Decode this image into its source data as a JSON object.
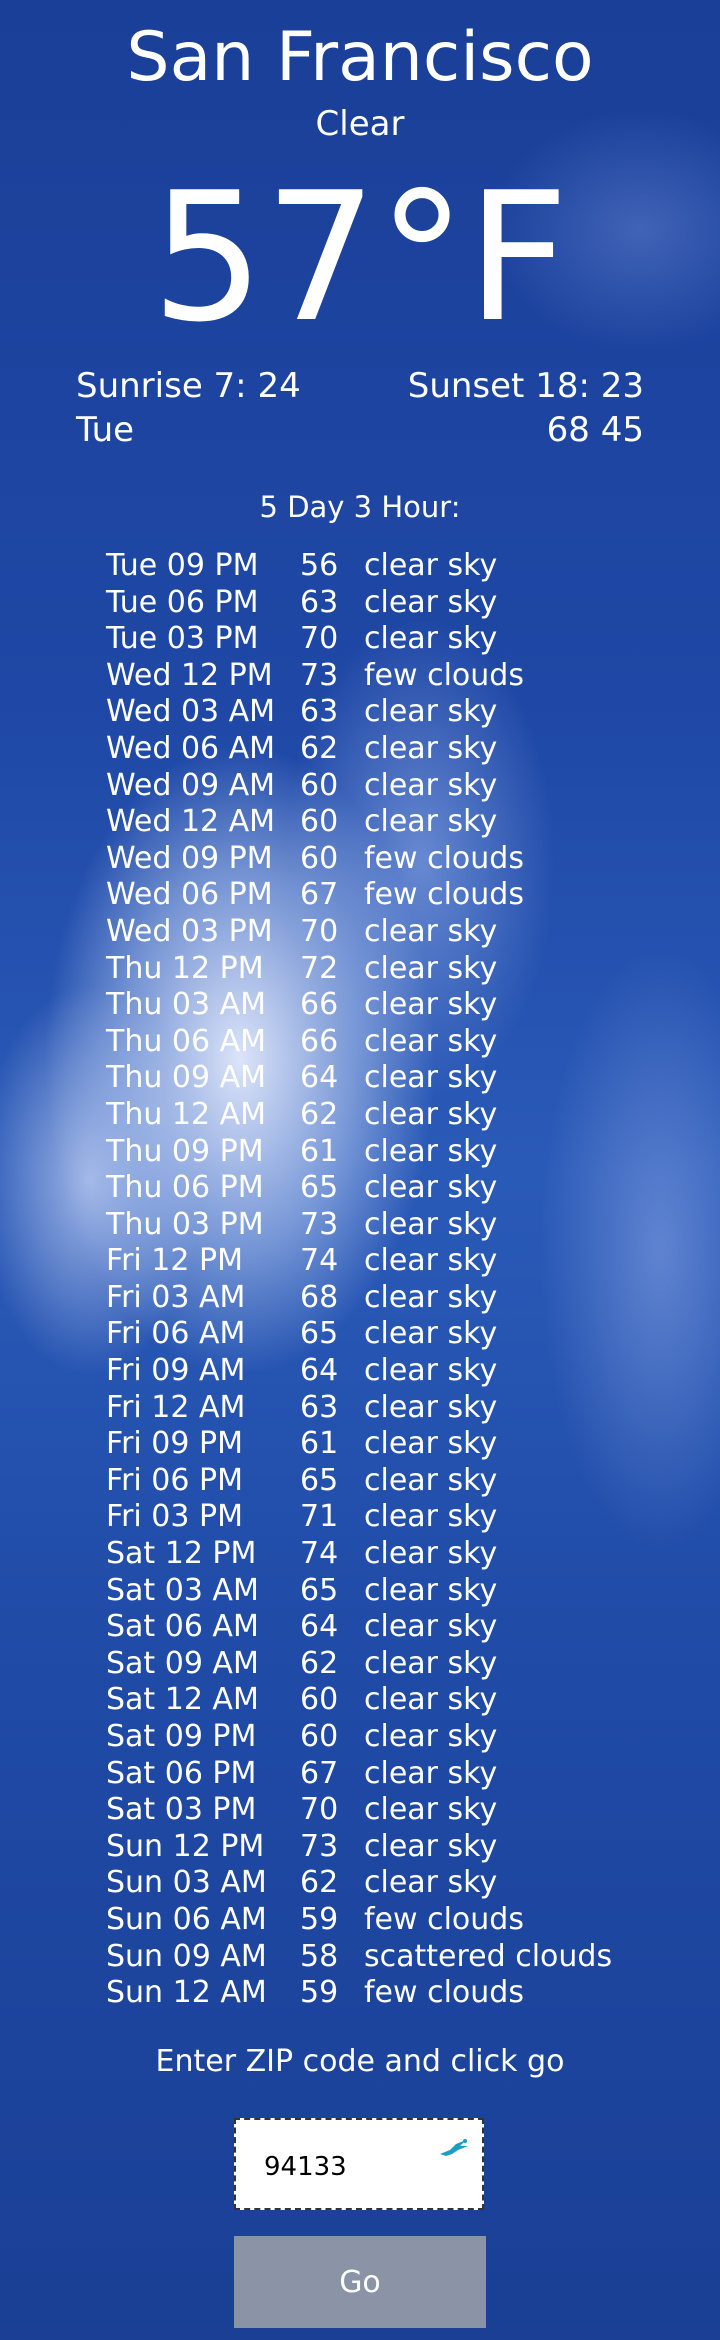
{
  "current": {
    "city": "San Francisco",
    "condition": "Clear",
    "temperature": "57°F",
    "sunrise": "Sunrise 7: 24",
    "sunset": "Sunset 18: 23",
    "day": "Tue",
    "high_low": "68 45"
  },
  "forecast": {
    "title": "5 Day 3 Hour:",
    "rows": [
      {
        "time": "Tue 09 PM",
        "temp": "56",
        "desc": "clear sky"
      },
      {
        "time": "Tue 06 PM",
        "temp": "63",
        "desc": "clear sky"
      },
      {
        "time": "Tue 03 PM",
        "temp": "70",
        "desc": "clear sky"
      },
      {
        "time": "Wed 12 PM",
        "temp": "73",
        "desc": "few clouds"
      },
      {
        "time": "Wed 03 AM",
        "temp": "63",
        "desc": "clear sky"
      },
      {
        "time": "Wed 06 AM",
        "temp": "62",
        "desc": "clear sky"
      },
      {
        "time": "Wed 09 AM",
        "temp": "60",
        "desc": "clear sky"
      },
      {
        "time": "Wed 12 AM",
        "temp": "60",
        "desc": "clear sky"
      },
      {
        "time": "Wed 09 PM",
        "temp": "60",
        "desc": "few clouds"
      },
      {
        "time": "Wed 06 PM",
        "temp": "67",
        "desc": "few clouds"
      },
      {
        "time": "Wed 03 PM",
        "temp": "70",
        "desc": "clear sky"
      },
      {
        "time": "Thu 12 PM",
        "temp": "72",
        "desc": "clear sky"
      },
      {
        "time": "Thu 03 AM",
        "temp": "66",
        "desc": "clear sky"
      },
      {
        "time": "Thu 06 AM",
        "temp": "66",
        "desc": "clear sky"
      },
      {
        "time": "Thu 09 AM",
        "temp": "64",
        "desc": "clear sky"
      },
      {
        "time": "Thu 12 AM",
        "temp": "62",
        "desc": "clear sky"
      },
      {
        "time": "Thu 09 PM",
        "temp": "61",
        "desc": "clear sky"
      },
      {
        "time": "Thu 06 PM",
        "temp": "65",
        "desc": "clear sky"
      },
      {
        "time": "Thu 03 PM",
        "temp": "73",
        "desc": "clear sky"
      },
      {
        "time": "Fri 12 PM",
        "temp": "74",
        "desc": "clear sky"
      },
      {
        "time": "Fri 03 AM",
        "temp": "68",
        "desc": "clear sky"
      },
      {
        "time": "Fri 06 AM",
        "temp": "65",
        "desc": "clear sky"
      },
      {
        "time": "Fri 09 AM",
        "temp": "64",
        "desc": "clear sky"
      },
      {
        "time": "Fri 12 AM",
        "temp": "63",
        "desc": "clear sky"
      },
      {
        "time": "Fri 09 PM",
        "temp": "61",
        "desc": "clear sky"
      },
      {
        "time": "Fri 06 PM",
        "temp": "65",
        "desc": "clear sky"
      },
      {
        "time": "Fri 03 PM",
        "temp": "71",
        "desc": "clear sky"
      },
      {
        "time": "Sat 12 PM",
        "temp": "74",
        "desc": "clear sky"
      },
      {
        "time": "Sat 03 AM",
        "temp": "65",
        "desc": "clear sky"
      },
      {
        "time": "Sat 06 AM",
        "temp": "64",
        "desc": "clear sky"
      },
      {
        "time": "Sat 09 AM",
        "temp": "62",
        "desc": "clear sky"
      },
      {
        "time": "Sat 12 AM",
        "temp": "60",
        "desc": "clear sky"
      },
      {
        "time": "Sat 09 PM",
        "temp": "60",
        "desc": "clear sky"
      },
      {
        "time": "Sat 06 PM",
        "temp": "67",
        "desc": "clear sky"
      },
      {
        "time": "Sat 03 PM",
        "temp": "70",
        "desc": "clear sky"
      },
      {
        "time": "Sun 12 PM",
        "temp": "73",
        "desc": "clear sky"
      },
      {
        "time": "Sun 03 AM",
        "temp": "62",
        "desc": "clear sky"
      },
      {
        "time": "Sun 06 AM",
        "temp": "59",
        "desc": "few clouds"
      },
      {
        "time": "Sun 09 AM",
        "temp": "58",
        "desc": "scattered clouds"
      },
      {
        "time": "Sun 12 AM",
        "temp": "59",
        "desc": "few clouds"
      }
    ]
  },
  "zip_form": {
    "prompt": "Enter ZIP code and click go",
    "value": "94133",
    "autofill_icon": "autofill-icon",
    "go_label": "Go",
    "button_color": "#8a94a6"
  }
}
